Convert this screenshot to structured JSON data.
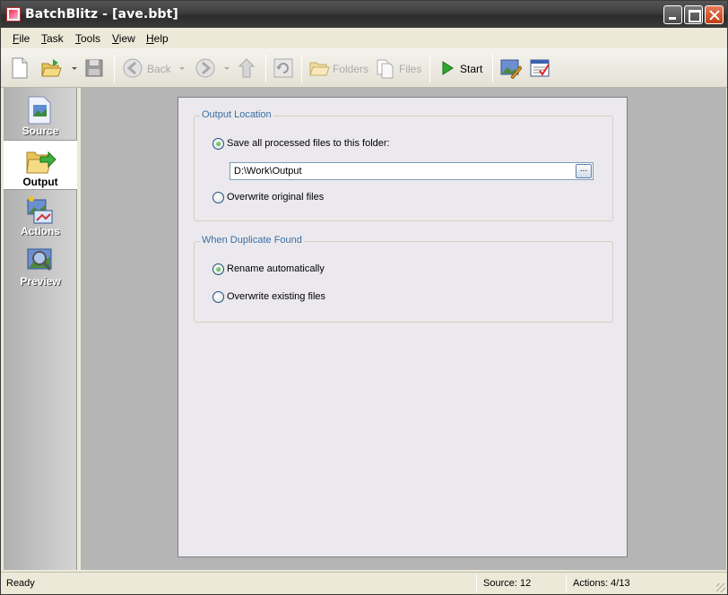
{
  "window": {
    "title": "BatchBlitz - [ave.bbt]"
  },
  "menu": {
    "items": [
      {
        "accel": "F",
        "rest": "ile"
      },
      {
        "accel": "T",
        "rest": "ask"
      },
      {
        "accel": "T",
        "rest": "ools"
      },
      {
        "accel": "V",
        "rest": "iew"
      },
      {
        "accel": "H",
        "rest": "elp"
      }
    ]
  },
  "toolbar": {
    "back_label": "Back",
    "folders_label": "Folders",
    "files_label": "Files",
    "start_label": "Start"
  },
  "sidebar": {
    "items": [
      {
        "label": "Source",
        "active": false
      },
      {
        "label": "Output",
        "active": true
      },
      {
        "label": "Actions",
        "active": false
      },
      {
        "label": "Preview",
        "active": false
      }
    ]
  },
  "output_location": {
    "title": "Output Location",
    "save_to_folder_label": "Save all processed files to this folder:",
    "save_to_folder_selected": true,
    "folder_path": "D:\\Work\\Output",
    "browse_label": "...",
    "overwrite_original_label": "Overwrite original files",
    "overwrite_original_selected": false
  },
  "duplicate": {
    "title": "When Duplicate Found",
    "rename_label": "Rename automatically",
    "rename_selected": true,
    "overwrite_existing_label": "Overwrite existing files",
    "overwrite_existing_selected": false
  },
  "status": {
    "state": "Ready",
    "source": "Source: 12",
    "actions": "Actions: 4/13"
  }
}
